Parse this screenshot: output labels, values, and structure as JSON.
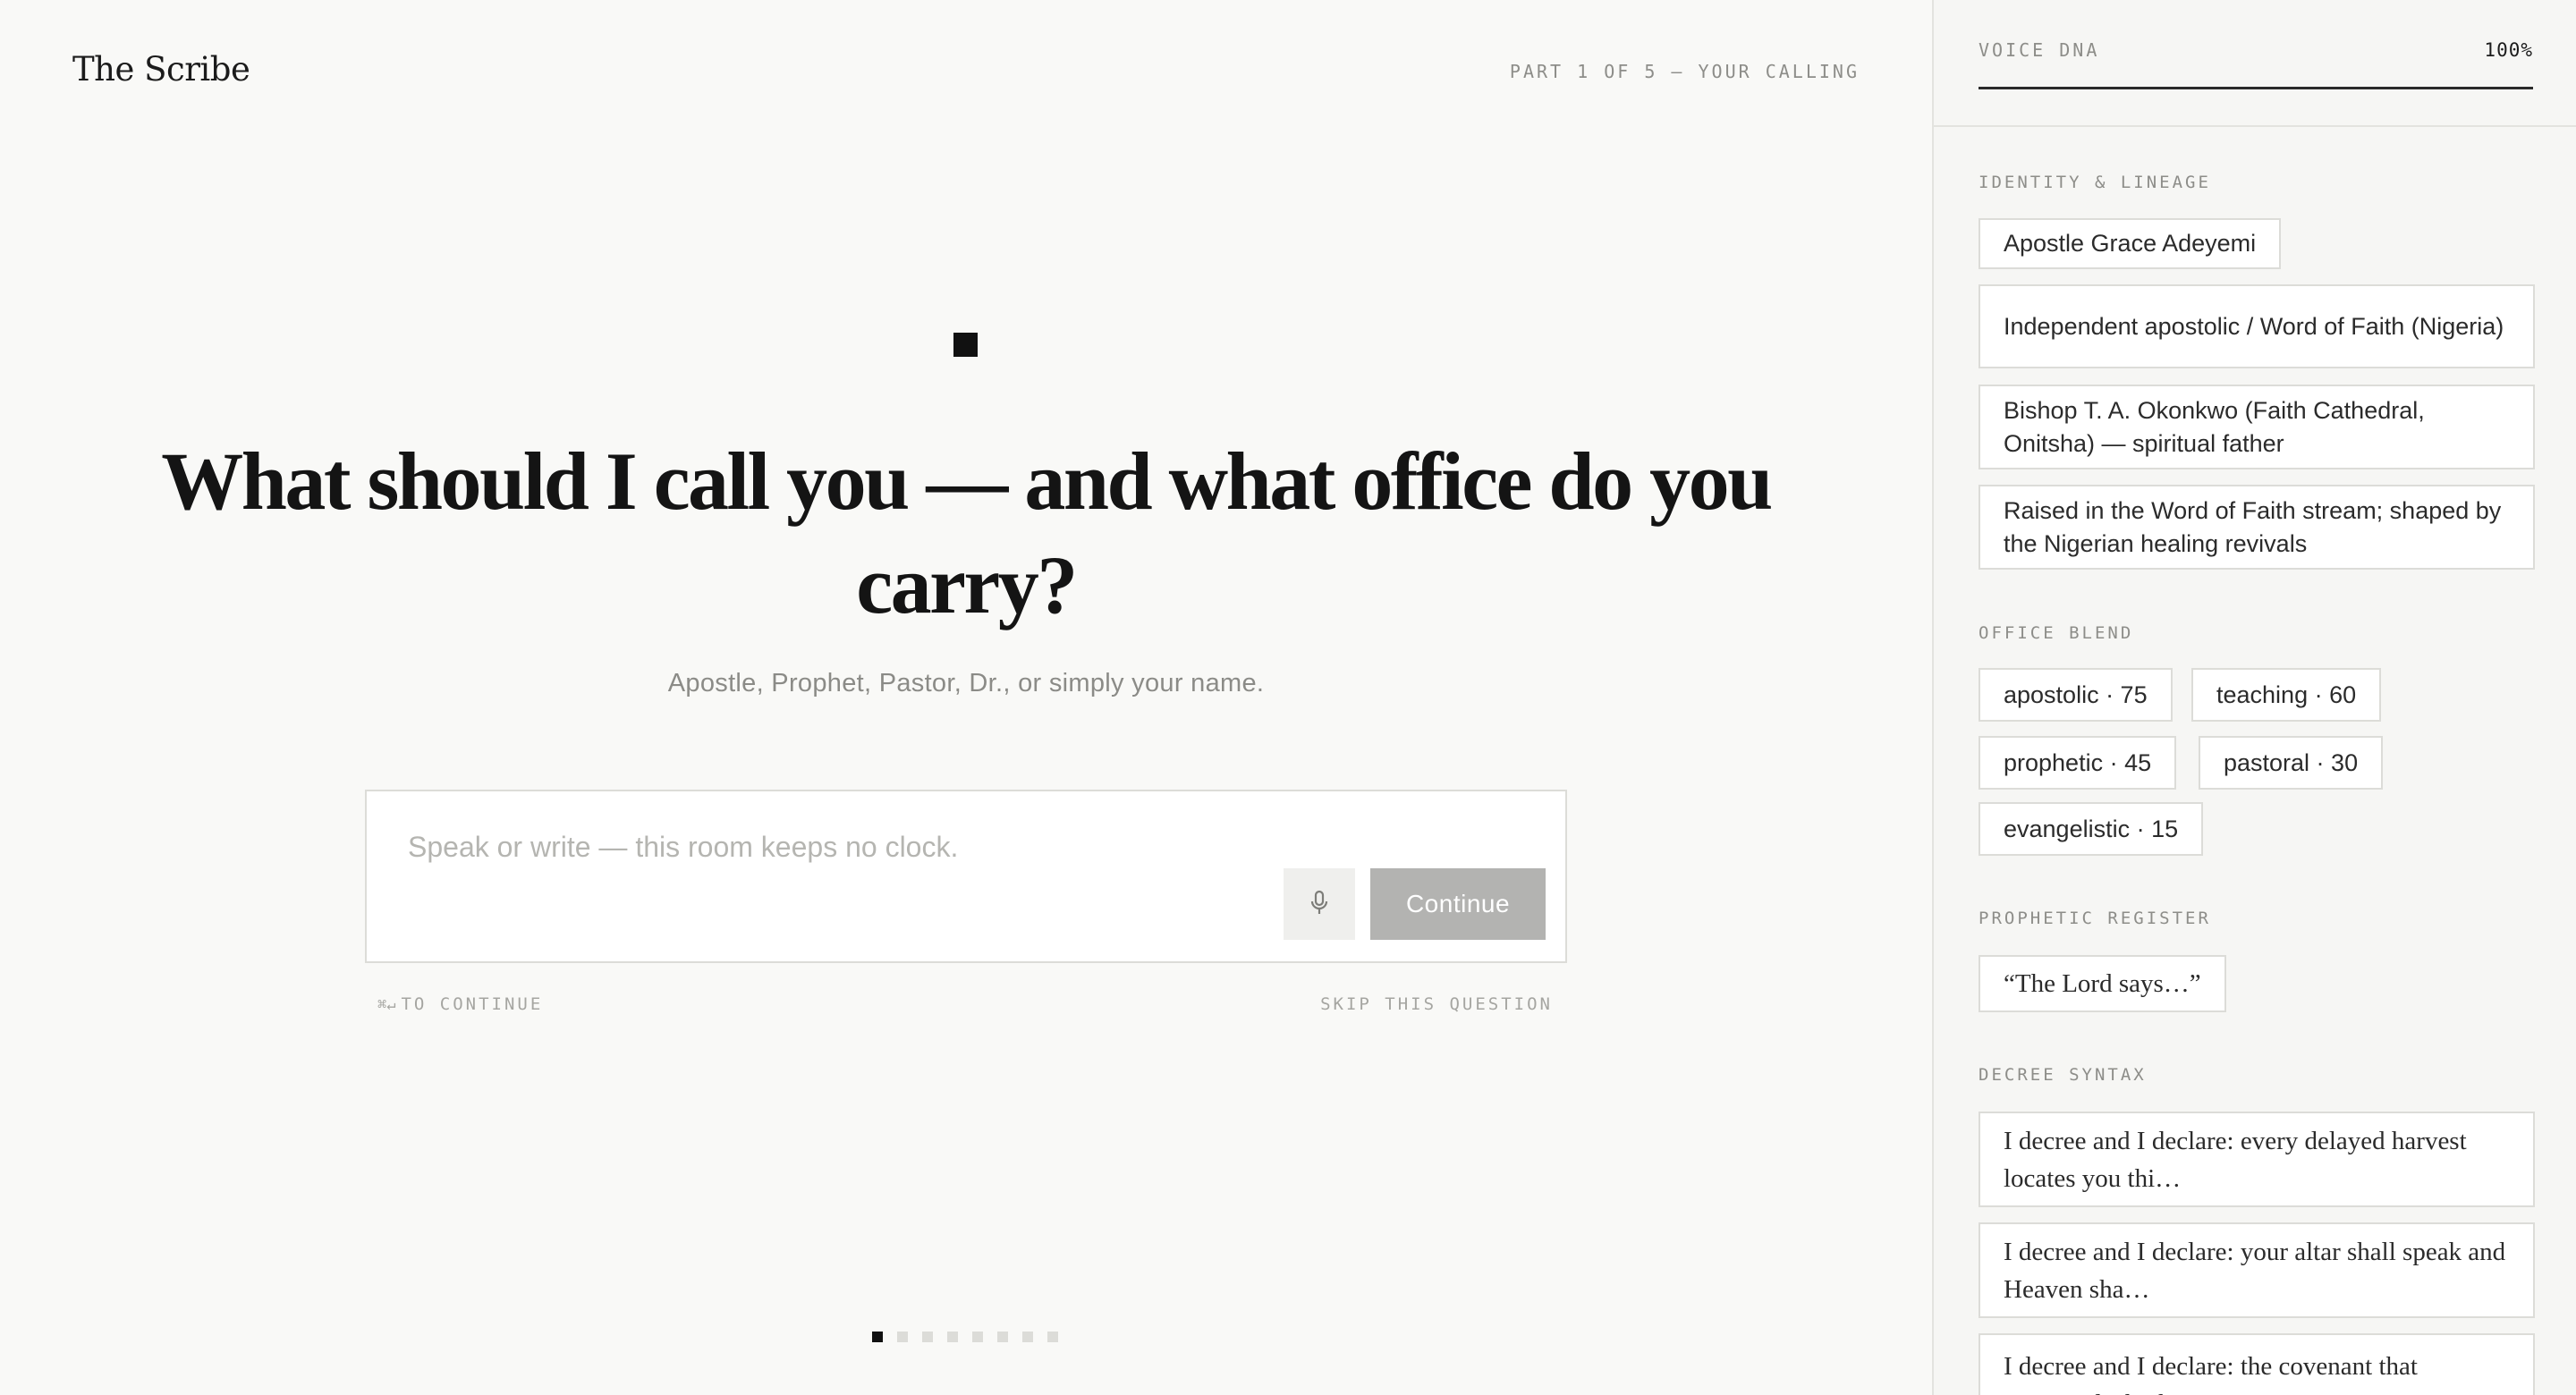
{
  "app": {
    "brand": "The Scribe",
    "progress_label": "PART 1 OF 5 — YOUR CALLING"
  },
  "question": {
    "text": "What should I call you — and what office do you carry?",
    "hint": "Apostle, Prophet, Pastor, Dr., or simply your name."
  },
  "answer": {
    "value": "",
    "placeholder": "Speak or write — this room keeps no clock.",
    "mic_icon": "microphone-icon",
    "continue_label": "Continue"
  },
  "footer": {
    "shortcut_icon": "⌘↵",
    "shortcut_label": "TO CONTINUE",
    "skip_label": "SKIP THIS QUESTION"
  },
  "pager": {
    "total": 8,
    "current": 1
  },
  "panel": {
    "title": "VOICE DNA",
    "percent": "100%",
    "identity": {
      "label": "IDENTITY & LINEAGE",
      "items": [
        "Apostle Grace Adeyemi",
        "Independent apostolic / Word of Faith (Nigeria)",
        "Bishop T. A. Okonkwo (Faith Cathedral, Onitsha) — spiritual father",
        "Raised in the Word of Faith stream; shaped by the Nigerian healing revivals"
      ]
    },
    "office_blend": {
      "label": "OFFICE BLEND",
      "items": [
        "apostolic · 75",
        "teaching · 60",
        "prophetic · 45",
        "pastoral · 30",
        "evangelistic · 15"
      ]
    },
    "prophetic_register": {
      "label": "PROPHETIC REGISTER",
      "items": [
        "“The Lord says…”"
      ]
    },
    "decree_syntax": {
      "label": "DECREE SYNTAX",
      "items": [
        "I decree and I declare: every delayed harvest locates you thi…",
        "I decree and I declare: your altar shall speak and Heaven sha…",
        "I decree and I declare: the covenant that answered Abraham…"
      ]
    }
  },
  "colors": {
    "background": "#f9f9f7",
    "panel_background": "#f6f6f4",
    "ink": "#141414",
    "muted": "#8d8d89",
    "border": "#dcdcd8",
    "button_disabled": "#b3b3b1"
  }
}
